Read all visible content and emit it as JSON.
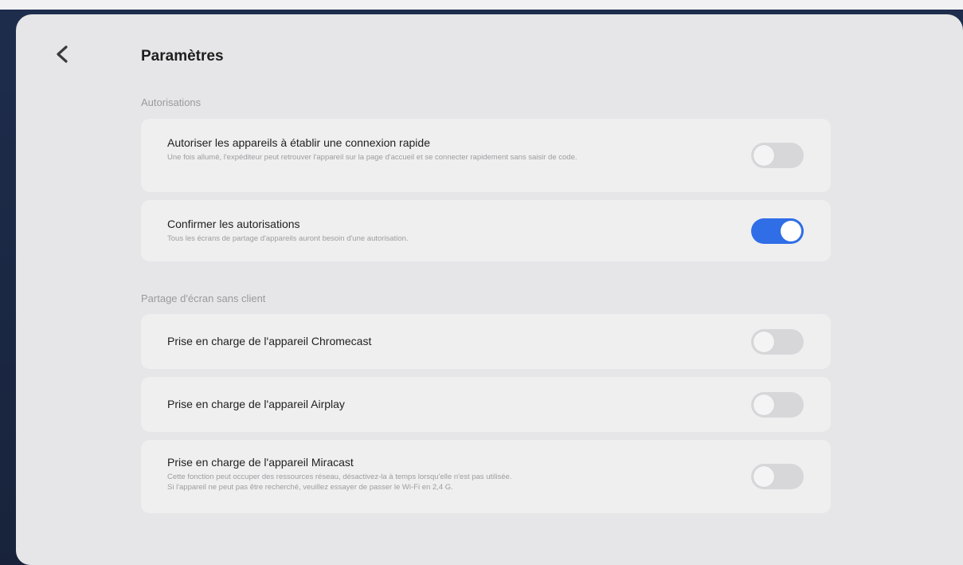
{
  "header": {
    "title": "Paramètres",
    "back_icon": "chevron-left-icon"
  },
  "sections": [
    {
      "label": "Autorisations",
      "items": [
        {
          "title": "Autoriser les appareils à établir une connexion rapide",
          "description": "Une fois allumé, l'expéditeur peut retrouver l'appareil sur la page d'accueil et se connecter rapidement sans saisir de code.",
          "enabled": false
        },
        {
          "title": "Confirmer les autorisations",
          "description": "Tous les écrans de partage d'appareils auront besoin d'une autorisation.",
          "enabled": true
        }
      ]
    },
    {
      "label": "Partage d'écran sans client",
      "items": [
        {
          "title": "Prise en charge de l'appareil Chromecast",
          "description": "",
          "enabled": false
        },
        {
          "title": "Prise en charge de l'appareil Airplay",
          "description": "",
          "enabled": false
        },
        {
          "title": "Prise en charge de l'appareil Miracast",
          "description": "Cette fonction peut occuper des ressources réseau, désactivez-la à temps lorsqu'elle n'est pas utilisée.",
          "description_2": "Si l'appareil ne peut pas être recherché, veuillez essayer de passer le Wi-Fi en 2,4 G.",
          "enabled": false
        }
      ]
    }
  ],
  "colors": {
    "toggle_on": "#2f6ee6",
    "toggle_off": "#d7d7da",
    "panel": "#e6e6e8",
    "card": "#efeff0"
  }
}
